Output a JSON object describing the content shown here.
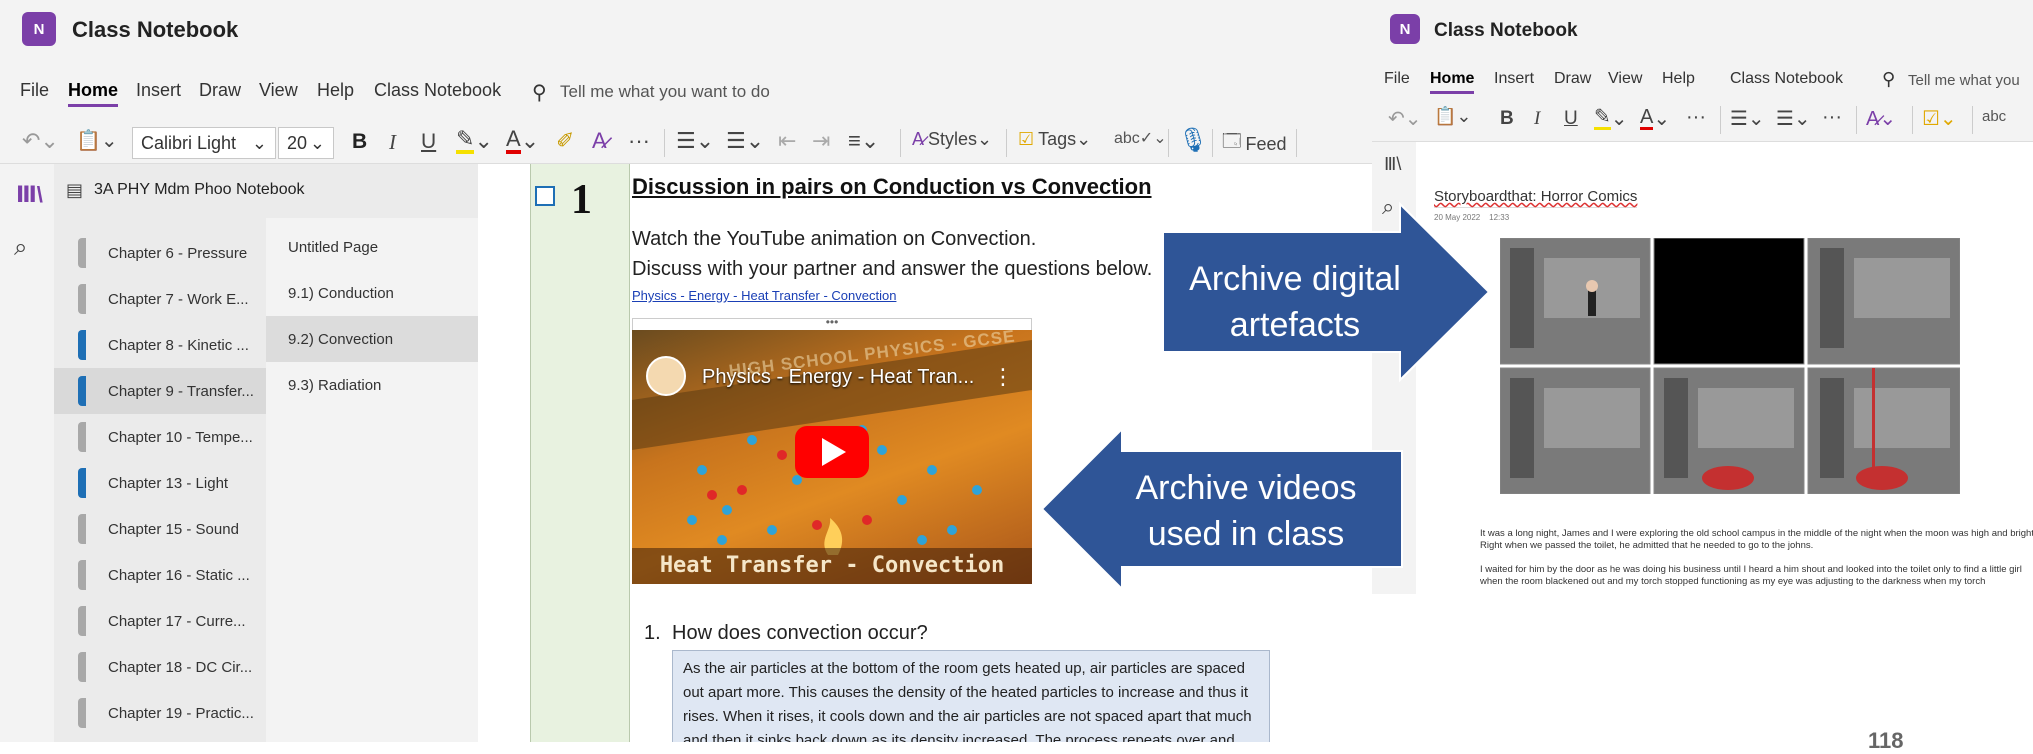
{
  "left": {
    "app_title": "Class Notebook",
    "logo_text": "N",
    "menu": [
      "File",
      "Home",
      "Insert",
      "Draw",
      "View",
      "Help",
      "Class Notebook"
    ],
    "tell_me": "Tell me what you want to do",
    "ribbon": {
      "font_name": "Calibri Light",
      "font_size": "20",
      "bold": "B",
      "italic": "I",
      "underline": "U",
      "more": "···",
      "styles": "Styles",
      "tags": "Tags",
      "feed": "Feed"
    },
    "notebook_name": "3A PHY Mdm Phoo Notebook",
    "sections": [
      {
        "label": "Chapter 6 - Pressure",
        "color": "#a8a8a8"
      },
      {
        "label": "Chapter 7 - Work E...",
        "color": "#a8a8a8"
      },
      {
        "label": "Chapter 8 - Kinetic ...",
        "color": "#1e6fb5"
      },
      {
        "label": "Chapter 9 - Transfer...",
        "color": "#1e6fb5"
      },
      {
        "label": "Chapter 10 - Tempe...",
        "color": "#a8a8a8"
      },
      {
        "label": "Chapter 13 - Light",
        "color": "#1e6fb5"
      },
      {
        "label": "Chapter 15 - Sound",
        "color": "#a8a8a8"
      },
      {
        "label": "Chapter 16 - Static ...",
        "color": "#a8a8a8"
      },
      {
        "label": "Chapter 17 - Curre...",
        "color": "#a8a8a8"
      },
      {
        "label": "Chapter 18 - DC Cir...",
        "color": "#a8a8a8"
      },
      {
        "label": "Chapter 19 - Practic...",
        "color": "#a8a8a8"
      }
    ],
    "pages": [
      "Untitled Page",
      "9.1) Conduction",
      "9.2) Convection",
      "9.3) Radiation"
    ],
    "page": {
      "number": "1",
      "heading": "Discussion in pairs on Conduction vs Convection",
      "line1": "Watch the YouTube animation on Convection.",
      "line2": "Discuss with your partner and answer the questions below.",
      "link": "Physics - Energy - Heat Transfer - Convection",
      "video_title": "Physics - Energy - Heat Tran...",
      "video_banner": "HIGH SCHOOL PHYSICS - GCSE",
      "video_caption": "Heat Transfer - Convection",
      "question_num": "1.",
      "question": "How does convection occur?",
      "answer": "As the air particles at the bottom of the room gets heated up, air particles are spaced out apart more. This causes the density of the heated particles to increase and thus it rises. When it rises, it cools down and the air particles are not spaced apart that much and then it sinks back down as its density increased. The process repeats over and over"
    }
  },
  "right": {
    "app_title": "Class Notebook",
    "menu": [
      "File",
      "Home",
      "Insert",
      "Draw",
      "View",
      "Help",
      "Class Notebook"
    ],
    "tell_me": "Tell me what you",
    "page_title": "Storyboardthat: Horror Comics",
    "page_date": "20 May 2022    12:33",
    "story_p1": "It was a long night, James and I were exploring the old school campus in the middle of the night when the moon was high and bright. Right when we passed the toilet, he admitted that he needed to go to the  johns.",
    "story_p2": "I waited for him by the door as he was doing his business until I heard a him shout and looked into the toilet only to find a little girl when the room blackened out and my torch stopped functioning as my eye was adjusting to the darkness when my torch"
  },
  "callouts": {
    "archive_digital": "Archive digital artefacts",
    "archive_videos": "Archive videos used in class",
    "arrow_color": "#2f5597"
  },
  "slide_number": "118"
}
